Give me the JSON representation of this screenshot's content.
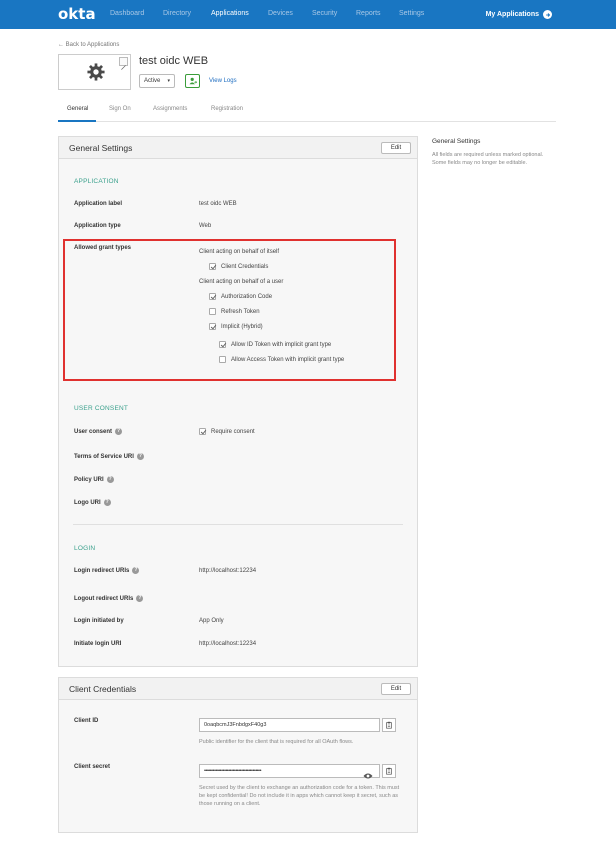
{
  "nav": {
    "logo": "okta",
    "items": [
      "Dashboard",
      "Directory",
      "Applications",
      "Devices",
      "Security",
      "Reports",
      "Settings"
    ],
    "active": "Applications",
    "my_apps": "My Applications"
  },
  "header": {
    "back_link": "← Back to Applications",
    "app_title": "test oidc WEB",
    "status": "Active",
    "view_logs": "View Logs"
  },
  "tabs": [
    "General",
    "Sign On",
    "Assignments",
    "Registration"
  ],
  "general_settings": {
    "title": "General Settings",
    "edit": "Edit",
    "application_section": "APPLICATION",
    "app_label_label": "Application label",
    "app_label_value": "test oidc WEB",
    "app_type_label": "Application type",
    "app_type_value": "Web",
    "grant_types_label": "Allowed grant types",
    "client_self": "Client acting on behalf of itself",
    "client_credentials": "Client Credentials",
    "client_user": "Client acting on behalf of a user",
    "authorization_code": "Authorization Code",
    "refresh_token": "Refresh Token",
    "implicit": "Implicit (Hybrid)",
    "allow_id_token": "Allow ID Token with implicit grant type",
    "allow_access_token": "Allow Access Token with implicit grant type",
    "consent_section": "USER CONSENT",
    "user_consent_label": "User consent",
    "require_consent": "Require consent",
    "tos_label": "Terms of Service URI",
    "policy_label": "Policy URI",
    "logo_label": "Logo URI",
    "login_section": "LOGIN",
    "login_redirect_label": "Login redirect URIs",
    "login_redirect_value": "http://localhost:12234",
    "logout_redirect_label": "Logout redirect URIs",
    "login_initiated_label": "Login initiated by",
    "login_initiated_value": "App Only",
    "initiate_login_label": "Initiate login URI",
    "initiate_login_value": "http://localhost:12234"
  },
  "checkbox_state": {
    "client_credentials": true,
    "authorization_code": true,
    "refresh_token": false,
    "implicit": true,
    "allow_id_token": true,
    "allow_access_token": false,
    "require_consent": true
  },
  "client_credentials": {
    "title": "Client Credentials",
    "edit": "Edit",
    "client_id_label": "Client ID",
    "client_id_value": "0oaqbcmJ3FnbdgxF40g3",
    "client_id_hint": "Public identifier for the client that is required for all OAuth flows.",
    "client_secret_label": "Client secret",
    "client_secret_value": "••••••••••••••••••••••••••••••••••••••••",
    "client_secret_hint": "Secret used by the client to exchange an authorization code for a token. This must be kept confidential! Do not include it in apps which cannot keep it secret, such as those running on a client."
  },
  "sidebar": {
    "title": "General Settings",
    "text": "All fields are required unless marked optional. Some fields may no longer be editable."
  }
}
